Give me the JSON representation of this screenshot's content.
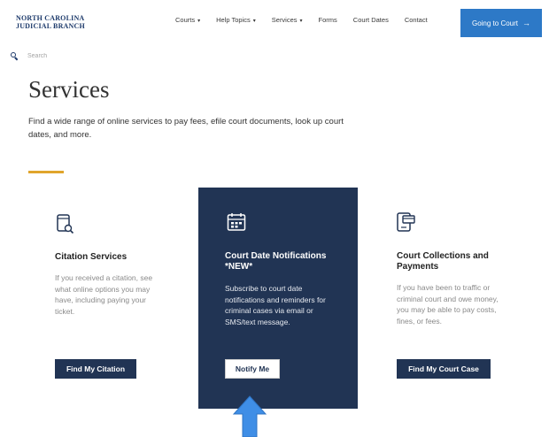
{
  "header": {
    "logo_line1": "NORTH CAROLINA",
    "logo_line2": "JUDICIAL BRANCH",
    "nav": [
      {
        "label": "Courts",
        "caret": true
      },
      {
        "label": "Help Topics",
        "caret": true
      },
      {
        "label": "Services",
        "caret": true
      },
      {
        "label": "Forms",
        "caret": false
      },
      {
        "label": "Court Dates",
        "caret": false
      },
      {
        "label": "Contact",
        "caret": false
      }
    ],
    "cta_label": "Going to Court",
    "cta_arrow": "→"
  },
  "search": {
    "placeholder": "Search"
  },
  "main": {
    "title": "Services",
    "intro": "Find a wide range of online services to pay fees, efile court documents, look up court dates, and more."
  },
  "cards": {
    "citation": {
      "icon": "citation-document-icon",
      "title": "Citation Services",
      "text": "If you received a citation, see what online options you may have, including paying your ticket.",
      "button": "Find My Citation"
    },
    "notifications": {
      "icon": "calendar-icon",
      "title": "Court Date Notifications *NEW*",
      "text": "Subscribe to court date notifications and reminders for criminal cases via email or SMS/text message.",
      "button": "Notify Me"
    },
    "collections": {
      "icon": "payment-device-icon",
      "title": "Court Collections and Payments",
      "text": "If you have been to traffic or criminal court and owe money, you may be able to pay costs, fines, or fees.",
      "button": "Find My Court Case"
    }
  },
  "colors": {
    "brand_navy": "#213454",
    "cta_blue": "#2d79c7",
    "accent_gold": "#e0a52c",
    "annotation_arrow": "#3f8ee6"
  }
}
